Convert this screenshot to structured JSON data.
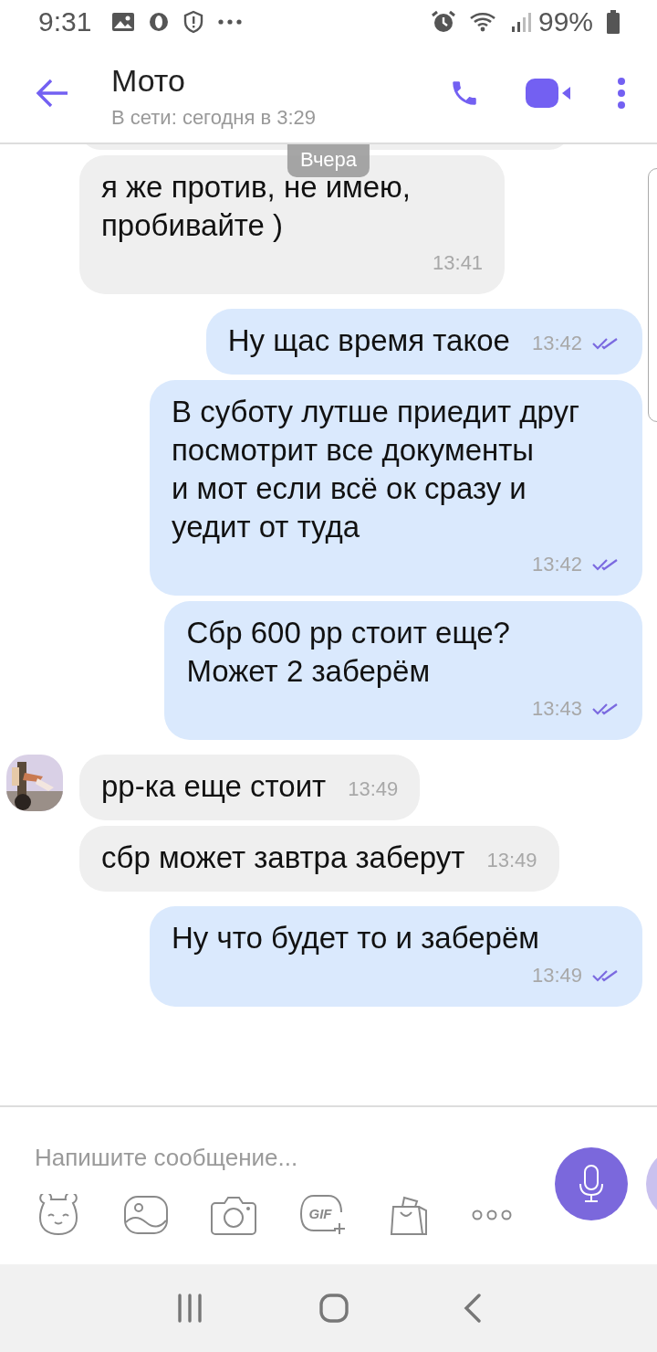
{
  "status_bar": {
    "time": "9:31",
    "battery": "99%"
  },
  "header": {
    "title": "Мото",
    "subtitle": "В сети: сегодня в 3:29"
  },
  "date_label": "Вчера",
  "messages": [
    {
      "kind": "incoming",
      "show_avatar": false,
      "text": "я же против, не имею,\nпробивайте )",
      "time": "13:41"
    },
    {
      "kind": "outgoing",
      "read": true,
      "text": "Ну щас время такое",
      "time": "13:42"
    },
    {
      "kind": "outgoing",
      "read": true,
      "text": "В суботу лутше приедит друг\nпосмотрит все документы\nи мот если всё ок сразу и\nуедит от туда",
      "time": "13:42"
    },
    {
      "kind": "outgoing",
      "read": true,
      "text": "Сбр 600 рр стоит еще?\nМожет 2 заберём",
      "time": "13:43"
    },
    {
      "kind": "incoming",
      "show_avatar": true,
      "text": "рр-ка еще стоит",
      "time": "13:49"
    },
    {
      "kind": "incoming",
      "show_avatar": false,
      "text": "сбр может завтра заберут",
      "time": "13:49"
    },
    {
      "kind": "outgoing",
      "read": true,
      "text": "Ну что будет то и заберём",
      "time": "13:49"
    }
  ],
  "composer": {
    "placeholder": "Напишите сообщение...",
    "gif_label": "GIF"
  }
}
